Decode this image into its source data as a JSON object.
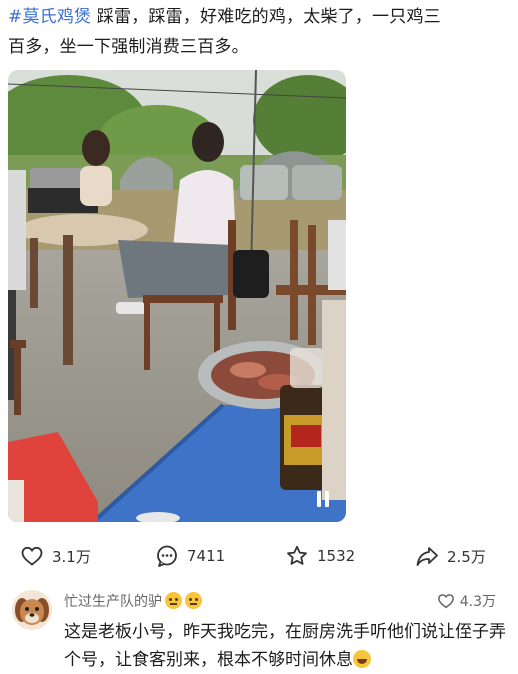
{
  "post": {
    "hashtag": "#莫氏鸡煲",
    "text_line1": " 踩雷，踩雷，好难吃的鸡，太柴了，一只鸡三",
    "text_line2": "百多，坐一下强制消费三百多。"
  },
  "video": {
    "state": "playing",
    "control_icon": "pause-icon"
  },
  "actions": {
    "like_count": "3.1万",
    "comment_count": "7411",
    "favorite_count": "1532",
    "share_count": "2.5万"
  },
  "comment": {
    "username": "忙过生产队的驴",
    "likes": "4.3万",
    "text": "这是老板小号，昨天我吃完，在厨房洗手听他们说让侄子弄个号，让食客别来，根本不够时间休息"
  },
  "colors": {
    "hashtag": "#3b6fd1",
    "text": "#1c1c1c",
    "secondary": "#666666",
    "table_blue": "#3f73c8"
  }
}
